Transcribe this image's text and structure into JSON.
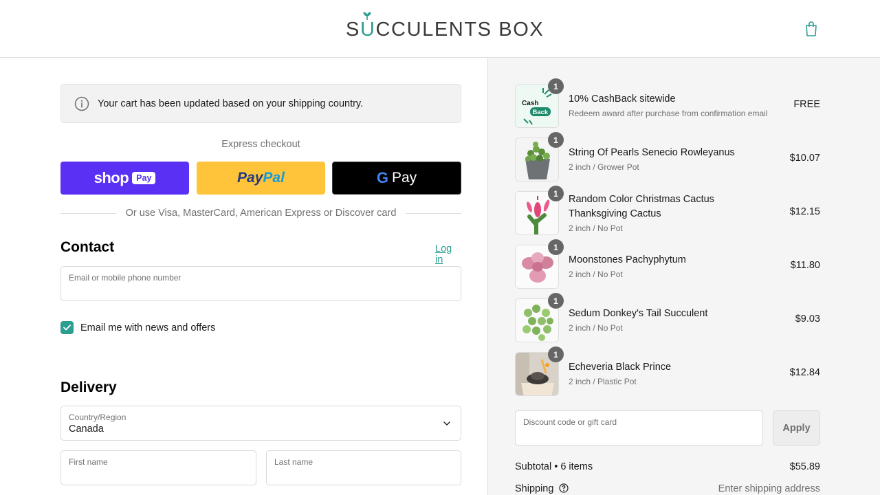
{
  "brand": {
    "logo_left": "S",
    "logo_u": "U",
    "logo_right": "CCULENTS BOX",
    "accent_color": "#2b9e8f"
  },
  "header": {
    "cart_icon": "shopping-bag-icon"
  },
  "notice": {
    "icon": "info-circle-icon",
    "text": "Your cart has been updated based on your shipping country."
  },
  "express": {
    "label": "Express checkout",
    "shop_pay_word": "shop",
    "shop_pay_badge": "Pay",
    "paypal_pay": "Pay",
    "paypal_pal": "Pal",
    "gpay_g": "G",
    "gpay_pay": "Pay",
    "divider_text": "Or use Visa, MasterCard, American Express or Discover card"
  },
  "contact": {
    "title": "Contact",
    "login_link": "Log in",
    "email_label": "Email or mobile phone number",
    "email_value": "",
    "newsletter_label": "Email me with news and offers",
    "newsletter_checked": true
  },
  "delivery": {
    "title": "Delivery",
    "country_label": "Country/Region",
    "country_value": "Canada",
    "first_name_label": "First name",
    "last_name_label": "Last name"
  },
  "summary": {
    "items": [
      {
        "qty": "1",
        "name": "10% CashBack sitewide",
        "variant": "Redeem award after purchase from confirmation email",
        "price": "FREE",
        "thumb_text_1": "Cash",
        "thumb_text_2": "Back"
      },
      {
        "qty": "1",
        "name": "String Of Pearls Senecio Rowleyanus",
        "variant": "2 inch / Grower Pot",
        "price": "$10.07"
      },
      {
        "qty": "1",
        "name": "Random Color Christmas Cactus Thanksgiving Cactus",
        "variant": "2 inch / No Pot",
        "price": "$12.15"
      },
      {
        "qty": "1",
        "name": "Moonstones Pachyphytum",
        "variant": "2 inch / No Pot",
        "price": "$11.80"
      },
      {
        "qty": "1",
        "name": "Sedum Donkey's Tail Succulent",
        "variant": "2 inch / No Pot",
        "price": "$9.03"
      },
      {
        "qty": "1",
        "name": "Echeveria Black Prince",
        "variant": "2 inch / Plastic Pot",
        "price": "$12.84"
      }
    ],
    "discount_label": "Discount code or gift card",
    "apply_label": "Apply",
    "subtotal_label": "Subtotal • 6 items",
    "subtotal_value": "$55.89",
    "shipping_label": "Shipping",
    "shipping_value": "Enter shipping address"
  }
}
